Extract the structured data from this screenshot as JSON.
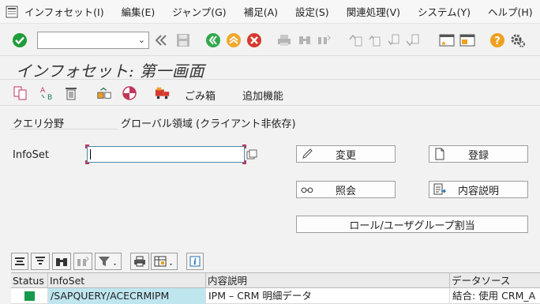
{
  "menubar": {
    "items": [
      "インフォセット(I)",
      "編集(E)",
      "ジャンプ(G)",
      "補足(A)",
      "設定(S)",
      "関連処理(V)",
      "システム(Y)",
      "ヘルプ(H)"
    ]
  },
  "toolbar": {
    "command_field": ""
  },
  "page": {
    "title": "インフォセット: 第一画面"
  },
  "apptoolbar": {
    "trash_label": "ごみ箱",
    "extra_label": "追加機能"
  },
  "form": {
    "query_area_label": "クエリ分野",
    "query_area_value": "グローバル領域 (クライアント非依存)",
    "infoset_label": "InfoSet",
    "infoset_value": ""
  },
  "buttons": {
    "change": "変更",
    "create": "登録",
    "display": "照会",
    "description": "内容説明",
    "role_assign": "ロール/ユーザグループ割当"
  },
  "grid": {
    "columns": [
      "Status",
      "InfoSet",
      "内容説明",
      "データソース"
    ],
    "rows": [
      {
        "status": "green",
        "infoset": "/SAPQUERY/ACECRMIPM",
        "description": "IPM – CRM 明細データ",
        "datasource": "結合: 使用 CRM_A"
      }
    ]
  },
  "colors": {
    "accept": "#1f9d3a",
    "cancel": "#d63a2f",
    "back": "#2fa84a",
    "exit": "#f2a72b",
    "selected_cell": "#bfe6ef",
    "status_green": "#159a4b"
  }
}
